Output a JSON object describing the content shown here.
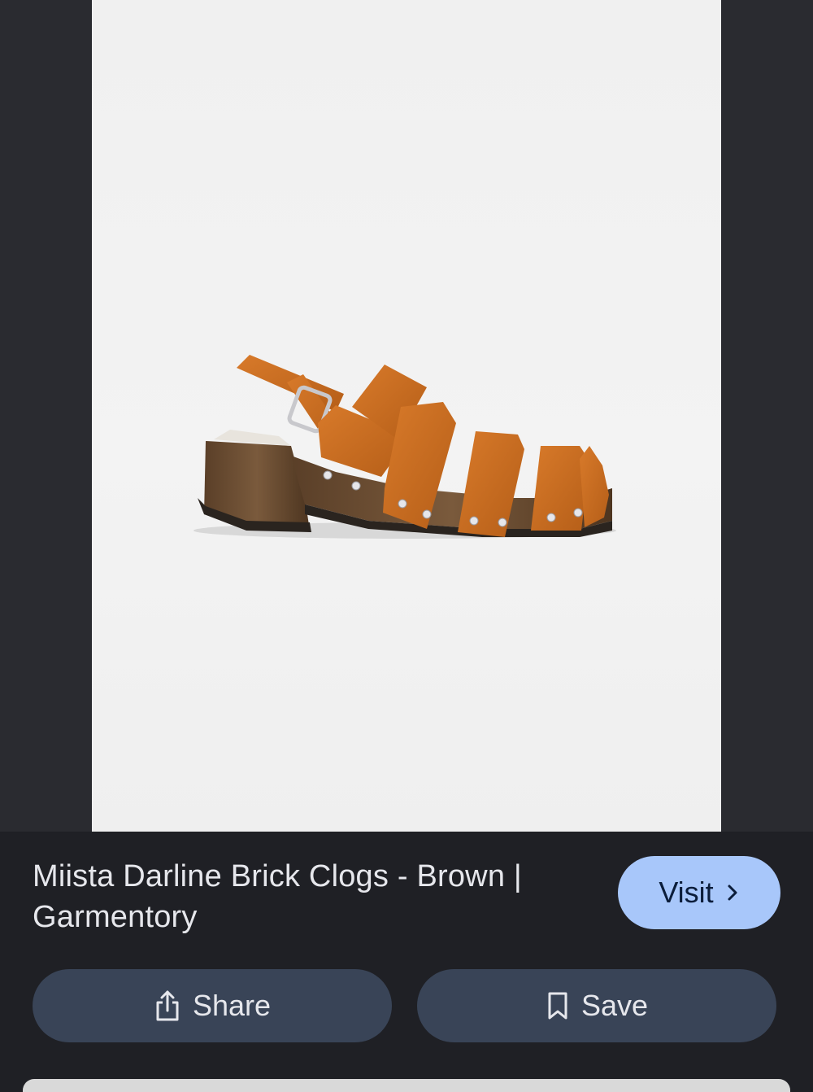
{
  "result": {
    "title": "Miista Darline Brick Clogs - Brown | Garmentory",
    "image_alt": "Miista Darline Brick Clogs - Brown"
  },
  "actions": {
    "visit_label": "Visit",
    "share_label": "Share",
    "save_label": "Save"
  },
  "icons": {
    "visit": "chevron-right-icon",
    "share": "share-icon",
    "save": "bookmark-icon"
  },
  "colors": {
    "visit_button": "#a8c7fa",
    "action_button": "#394457",
    "panel_background": "#1f2025",
    "leather": "#c96b1e"
  }
}
